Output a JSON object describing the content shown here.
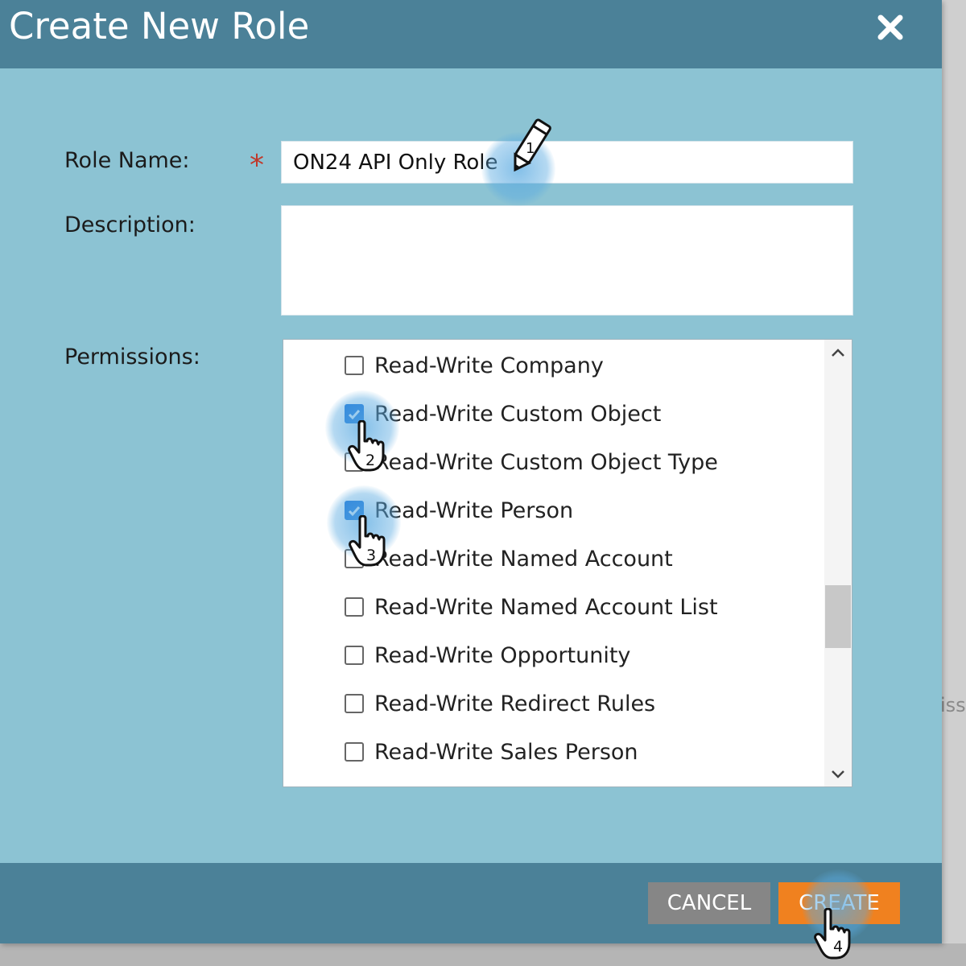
{
  "dialog": {
    "title": "Create New Role",
    "close_icon": "close-icon"
  },
  "form": {
    "role_name_label": "Role Name:",
    "required_marker": "*",
    "role_name_value": "ON24 API Only Role",
    "description_label": "Description:",
    "description_value": "",
    "permissions_label": "Permissions:"
  },
  "permissions": [
    {
      "label": "Read-Write Company",
      "checked": false
    },
    {
      "label": "Read-Write Custom Object",
      "checked": true
    },
    {
      "label": "Read-Write Custom Object Type",
      "checked": false
    },
    {
      "label": "Read-Write Person",
      "checked": true
    },
    {
      "label": "Read-Write Named Account",
      "checked": false
    },
    {
      "label": "Read-Write Named Account List",
      "checked": false
    },
    {
      "label": "Read-Write Opportunity",
      "checked": false
    },
    {
      "label": "Read-Write Redirect Rules",
      "checked": false
    },
    {
      "label": "Read-Write Sales Person",
      "checked": false
    }
  ],
  "buttons": {
    "cancel": "CANCEL",
    "create": "CREATE"
  },
  "step_markers": [
    "1",
    "2",
    "3",
    "4"
  ],
  "background_peek_text": "iss",
  "colors": {
    "header": "#4b8198",
    "dialog_body": "#8cc3d3",
    "create_button": "#f0811f",
    "cancel_button": "#868686",
    "checkbox_checked": "#1a73d9",
    "required": "#c0392b"
  }
}
